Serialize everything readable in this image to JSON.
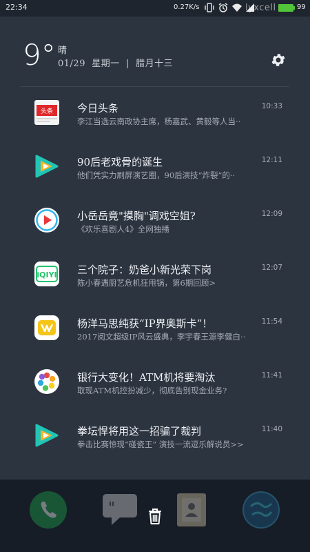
{
  "status_bar": {
    "time": "22:34",
    "net_speed": "0.27K/s",
    "watermark": "lyxcell",
    "battery": "99",
    "icons": [
      "vibrate-icon",
      "alarm-icon",
      "wifi-icon",
      "signal-icon"
    ]
  },
  "header": {
    "temperature": "9°",
    "condition": "晴",
    "date_line": "01/29  星期一  |  腊月十三",
    "settings_icon": "gear-icon"
  },
  "notifications": [
    {
      "app": "今日头条",
      "icon": "toutiao-app-icon",
      "title": "今日头条",
      "body": "李江当选云南政协主席，杨嘉武、黄毅等人当··",
      "time": "10:33"
    },
    {
      "app": "腾讯视频",
      "icon": "tencent-video-app-icon",
      "title": "90后老戏骨的诞生",
      "body": "他们凭实力刷屏演艺圈，90后演技“炸裂”的··",
      "time": "12:11"
    },
    {
      "app": "视频",
      "icon": "play-circle-app-icon",
      "title": "小岳岳竟\"摸胸\"调戏空姐?",
      "body": "《欢乐喜剧人4》全网独播",
      "time": "12:09"
    },
    {
      "app": "爱奇艺",
      "icon": "iqiyi-app-icon",
      "title": "三个院子：奶爸小新光荣下岗",
      "body": "陈小春遇厨艺危机狂甩锅，第6期回顾>",
      "time": "12:07"
    },
    {
      "app": "优酷",
      "icon": "youku-app-icon",
      "title": "杨洋马思纯获“IP界奥斯卡”！",
      "body": "2017阅文超级IP风云盛典，李宇春王源李健白··",
      "time": "11:54"
    },
    {
      "app": "新闻",
      "icon": "dots-app-icon",
      "title": "银行大变化！ATM机将要淘汰",
      "body": "取现ATM机控扮减少，彻底告别现金业务?",
      "time": "11:41"
    },
    {
      "app": "腾讯视频",
      "icon": "tencent-video-app-icon",
      "title": "拳坛悍将用这一招骗了裁判",
      "body": "拳击比赛惊现“碰瓷王” 演技一流逗乐解说员>>",
      "time": "11:40"
    }
  ],
  "dock": {
    "apps": [
      "phone-app-icon",
      "messages-app-icon",
      "contacts-app-icon",
      "browser-app-icon"
    ],
    "trash_icon": "trash-icon"
  },
  "colors": {
    "background": "#2c3440",
    "dock": "#161d27",
    "battery": "#52c43a",
    "toutiao_red": "#e0272a",
    "tencent_teal": "#22c4b5"
  }
}
